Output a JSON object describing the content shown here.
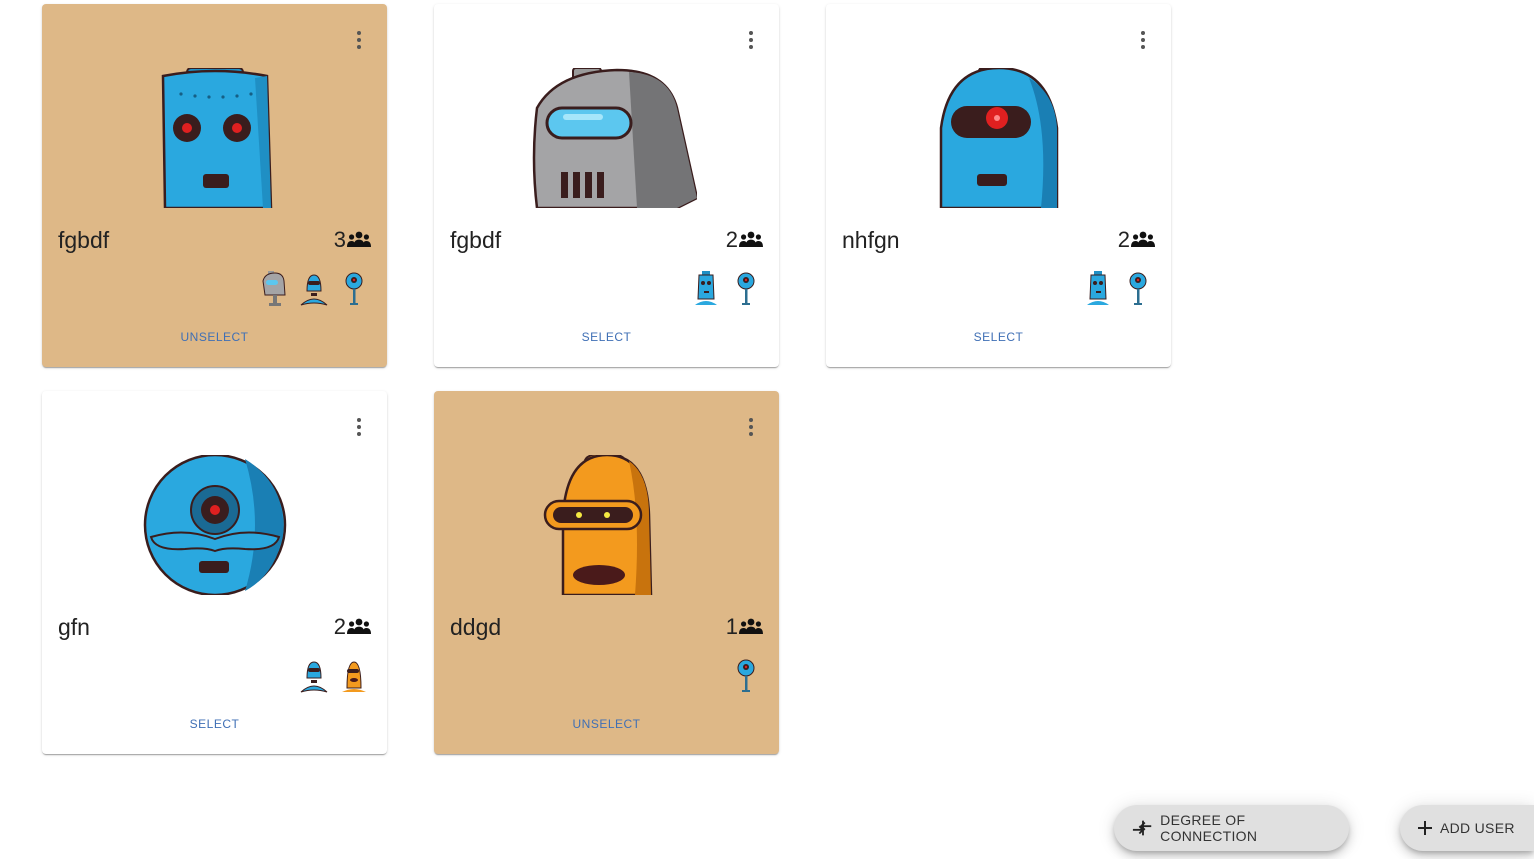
{
  "cards": [
    {
      "name": "fgbdf",
      "count": "3",
      "action": "UNSELECT",
      "selected": true,
      "avatar": "blue-boxy-robot"
    },
    {
      "name": "fgbdf",
      "count": "2",
      "action": "SELECT",
      "selected": false,
      "avatar": "gray-helmet-robot"
    },
    {
      "name": "nhfgn",
      "count": "2",
      "action": "SELECT",
      "selected": false,
      "avatar": "blue-cyclops-robot"
    },
    {
      "name": "gfn",
      "count": "2",
      "action": "SELECT",
      "selected": false,
      "avatar": "blue-round-robot"
    },
    {
      "name": "ddgd",
      "count": "1",
      "action": "UNSELECT",
      "selected": true,
      "avatar": "orange-robot"
    }
  ],
  "fabs": {
    "degree_label": "DEGREE OF CONNECTION",
    "add_user_label": "ADD USER"
  },
  "colors": {
    "selected_bg": "#deb887",
    "link": "#3f6fb5",
    "robot_blue": "#2aa8df",
    "robot_orange": "#f39a1e"
  }
}
